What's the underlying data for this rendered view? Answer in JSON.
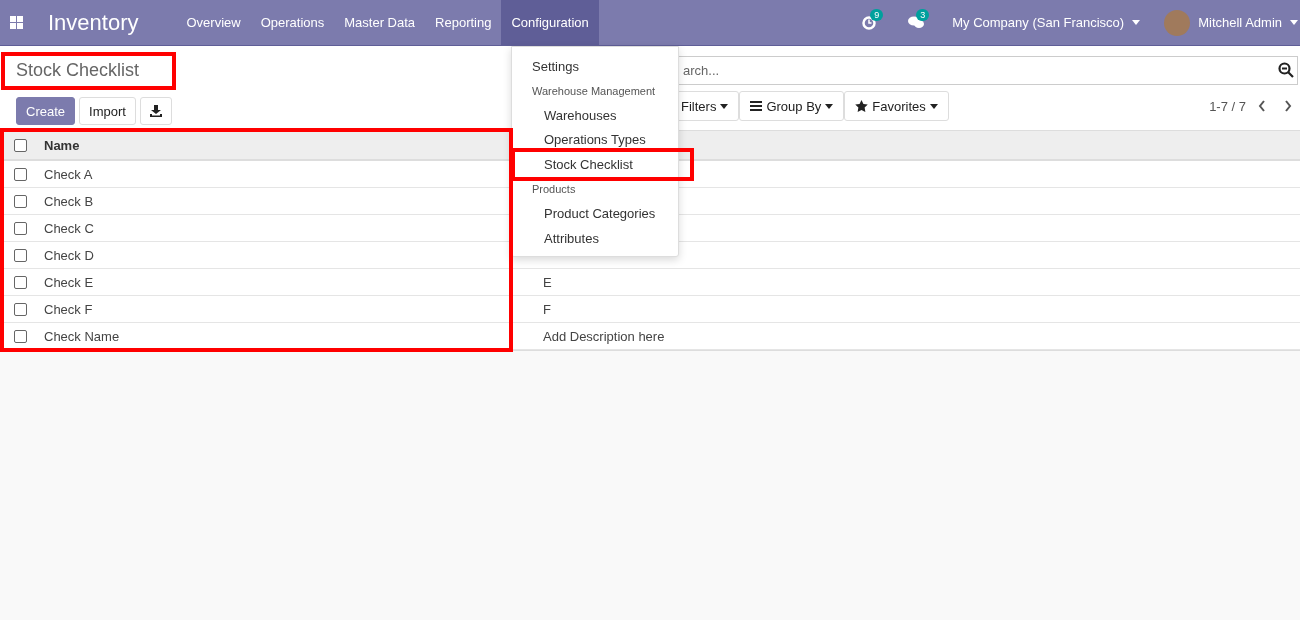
{
  "navbar": {
    "app": "Inventory",
    "menus": [
      {
        "label": "Overview",
        "selected": false
      },
      {
        "label": "Operations",
        "selected": false
      },
      {
        "label": "Master Data",
        "selected": false
      },
      {
        "label": "Reporting",
        "selected": false
      },
      {
        "label": "Configuration",
        "selected": true
      }
    ],
    "activity_badge": "9",
    "message_badge": "3",
    "company": "My Company (San Francisco)",
    "user": "Mitchell Admin"
  },
  "breadcrumb": "Stock Checklist",
  "buttons": {
    "create": "Create",
    "import": "Import"
  },
  "search": {
    "placeholder": "arch..."
  },
  "filters": [
    {
      "kind": "filter",
      "label": "Filters"
    },
    {
      "kind": "group",
      "label": "Group By"
    },
    {
      "kind": "favorite",
      "label": "Favorites"
    }
  ],
  "pager": "1-7 / 7",
  "table": {
    "columns": [
      "Name"
    ],
    "all_checked": false,
    "rows": [
      {
        "name": "Check A",
        "checked": false
      },
      {
        "name": "Check B",
        "checked": false
      },
      {
        "name": "Check C",
        "checked": false
      },
      {
        "name": "Check D",
        "checked": false
      },
      {
        "name": "Check E",
        "checked": false,
        "description": "E"
      },
      {
        "name": "Check F",
        "checked": false,
        "description": "F"
      },
      {
        "name": "Check Name",
        "checked": false,
        "description": "Add Description here"
      }
    ]
  },
  "dropdown": {
    "items": [
      {
        "kind": "item",
        "label": "Settings"
      },
      {
        "kind": "header",
        "label": "Warehouse Management"
      },
      {
        "kind": "subitem",
        "label": "Warehouses"
      },
      {
        "kind": "subitem",
        "label": "Operations Types"
      },
      {
        "kind": "subitem",
        "label": "Stock Checklist",
        "highlighted": true
      },
      {
        "kind": "header",
        "label": "Products"
      },
      {
        "kind": "subitem",
        "label": "Product Categories"
      },
      {
        "kind": "subitem",
        "label": "Attributes"
      }
    ]
  }
}
